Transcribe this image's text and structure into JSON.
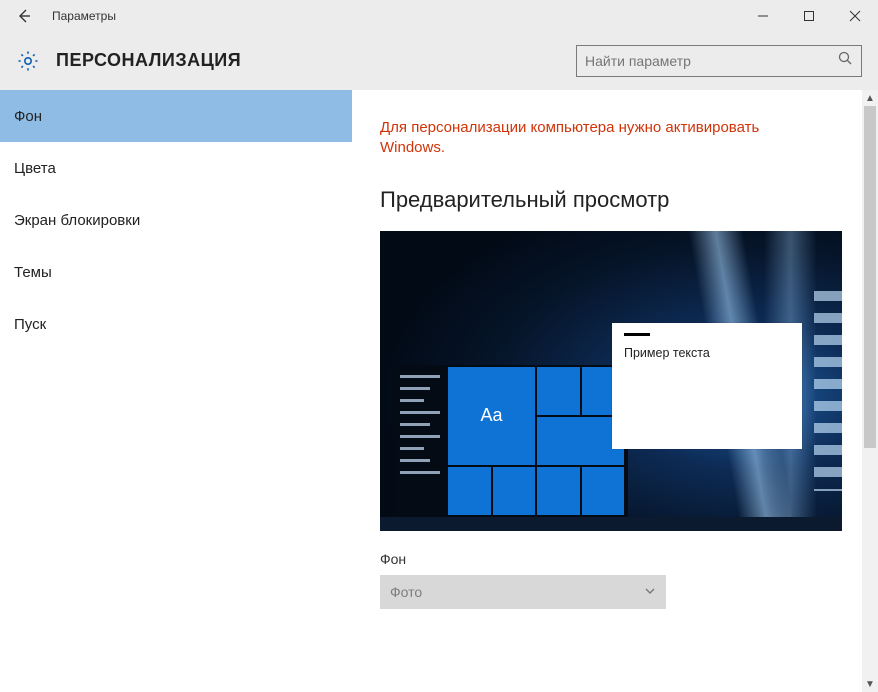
{
  "window": {
    "title": "Параметры"
  },
  "header": {
    "heading": "ПЕРСОНАЛИЗАЦИЯ"
  },
  "search": {
    "placeholder": "Найти параметр"
  },
  "sidebar": {
    "items": [
      {
        "label": "Фон",
        "selected": true
      },
      {
        "label": "Цвета",
        "selected": false
      },
      {
        "label": "Экран блокировки",
        "selected": false
      },
      {
        "label": "Темы",
        "selected": false
      },
      {
        "label": "Пуск",
        "selected": false
      }
    ]
  },
  "content": {
    "activation_message": "Для персонализации компьютера нужно активировать Windows.",
    "preview_title": "Предварительный просмотр",
    "sample_text": "Пример текста",
    "tile_text": "Aa",
    "background_label": "Фон",
    "background_value": "Фото"
  }
}
